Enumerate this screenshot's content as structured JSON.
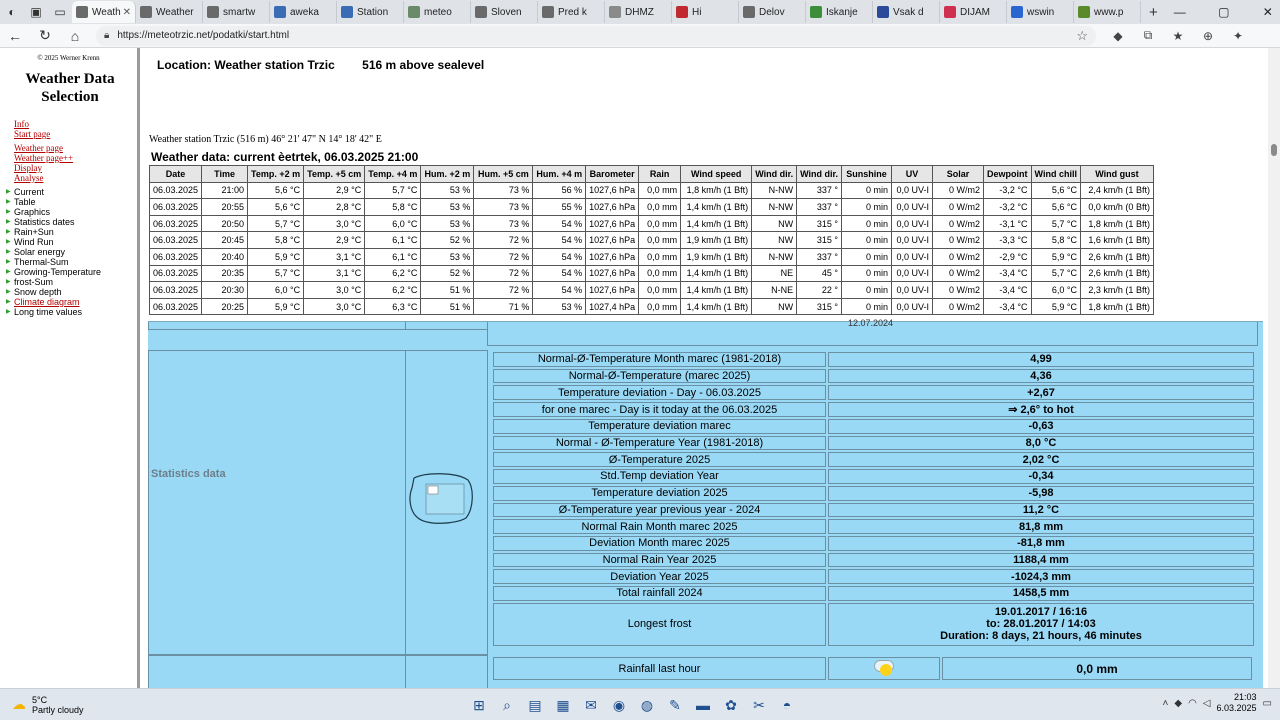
{
  "browser": {
    "tabs": [
      {
        "label": "Weather",
        "active": true,
        "color": "#6a6a6a",
        "icon": "globe-icon"
      },
      {
        "label": "Weather",
        "color": "#6a6a6a",
        "icon": "globe-icon"
      },
      {
        "label": "smartw",
        "color": "#6a6a6a",
        "icon": "globe-icon"
      },
      {
        "label": "aweka",
        "color": "#3a6bb5",
        "icon": "triangle-icon"
      },
      {
        "label": "Station",
        "color": "#3a6bb5",
        "icon": "triangle-icon"
      },
      {
        "label": "meteo",
        "color": "#6a8a6a",
        "icon": "meteo-icon"
      },
      {
        "label": "Sloven",
        "color": "#6a6a6a",
        "icon": "globe-icon"
      },
      {
        "label": "Pred k",
        "color": "#6a6a6a",
        "icon": "globe-icon"
      },
      {
        "label": "DHMZ",
        "color": "#8a8a8a",
        "icon": "page-icon"
      },
      {
        "label": "Hi",
        "color": "#c0292f",
        "icon": "flag-icon"
      },
      {
        "label": "Delov",
        "color": "#6a6a6a",
        "icon": "page-icon"
      },
      {
        "label": "Iskanje",
        "color": "#3b8f3b",
        "icon": "leaf-icon"
      },
      {
        "label": "Vsak d",
        "color": "#2c4a9a",
        "icon": "news-icon"
      },
      {
        "label": "DIJAM",
        "color": "#d03050",
        "icon": "play-icon"
      },
      {
        "label": "wswin",
        "color": "#2a66d0",
        "icon": "search-icon"
      },
      {
        "label": "www.p",
        "color": "#5a8a2a",
        "icon": "site-icon"
      }
    ],
    "url": "https://meteotrzic.net/podatki/start.html"
  },
  "sidebar": {
    "copyright": "© 2025 Werner Krenn",
    "title": "Weather Data Selection",
    "links": [
      "Info",
      "Start page"
    ],
    "links2": [
      "Weather page",
      "Weather page++",
      "Display",
      "Analyse"
    ],
    "list": [
      {
        "label": "Current",
        "link": false
      },
      {
        "label": "Table",
        "link": false
      },
      {
        "label": "Graphics",
        "link": false
      },
      {
        "label": "Statistics dates",
        "link": false
      },
      {
        "label": "Rain+Sun",
        "link": false
      },
      {
        "label": "Wind Run",
        "link": false
      },
      {
        "label": "Solar energy",
        "link": false
      },
      {
        "label": "Thermal-Sum",
        "link": false
      },
      {
        "label": "Growing-Temperature",
        "link": false
      },
      {
        "label": "frost-Sum",
        "link": false
      },
      {
        "label": "Snow depth",
        "link": false
      },
      {
        "label": "Climate diagram",
        "link": true
      },
      {
        "label": "Long time values",
        "link": false
      }
    ]
  },
  "content": {
    "location": "Location: Weather station Trzic",
    "elevation": "516 m above sealevel",
    "station_line": "Weather station Trzic (516 m) 46° 21' 47\" N 14° 18' 42\" E",
    "data_title": "Weather data: current èetrtek, 06.03.2025 21:00",
    "stats_label": "Statistics data",
    "partial_date": "12.07.2024"
  },
  "table": {
    "headers": [
      "Date",
      "Time",
      "Temp. +2 m",
      "Temp. +5 cm",
      "Temp. +4 m",
      "Hum. +2 m",
      "Hum. +5 cm",
      "Hum. +4 m",
      "Barometer",
      "Rain",
      "Wind speed",
      "Wind dir.",
      "Wind dir.",
      "Sunshine",
      "UV",
      "Solar",
      "Dewpoint",
      "Wind chill",
      "Wind gust"
    ],
    "rows": [
      [
        "06.03.2025",
        "21:00",
        "5,6 °C",
        "2,9 °C",
        "5,7 °C",
        "53 %",
        "73 %",
        "56 %",
        "1027,6 hPa",
        "0,0 mm",
        "1,8 km/h (1 Bft)",
        "N-NW",
        "337 °",
        "0 min",
        "0,0 UV-I",
        "0 W/m2",
        "-3,2 °C",
        "5,6 °C",
        "2,4 km/h (1 Bft)"
      ],
      [
        "06.03.2025",
        "20:55",
        "5,6 °C",
        "2,8 °C",
        "5,8 °C",
        "53 %",
        "73 %",
        "55 %",
        "1027,6 hPa",
        "0,0 mm",
        "1,4 km/h (1 Bft)",
        "N-NW",
        "337 °",
        "0 min",
        "0,0 UV-I",
        "0 W/m2",
        "-3,2 °C",
        "5,6 °C",
        "0,0 km/h (0 Bft)"
      ],
      [
        "06.03.2025",
        "20:50",
        "5,7 °C",
        "3,0 °C",
        "6,0 °C",
        "53 %",
        "73 %",
        "54 %",
        "1027,6 hPa",
        "0,0 mm",
        "1,4 km/h (1 Bft)",
        "NW",
        "315 °",
        "0 min",
        "0,0 UV-I",
        "0 W/m2",
        "-3,1 °C",
        "5,7 °C",
        "1,8 km/h (1 Bft)"
      ],
      [
        "06.03.2025",
        "20:45",
        "5,8 °C",
        "2,9 °C",
        "6,1 °C",
        "52 %",
        "72 %",
        "54 %",
        "1027,6 hPa",
        "0,0 mm",
        "1,9 km/h (1 Bft)",
        "NW",
        "315 °",
        "0 min",
        "0,0 UV-I",
        "0 W/m2",
        "-3,3 °C",
        "5,8 °C",
        "1,6 km/h (1 Bft)"
      ],
      [
        "06.03.2025",
        "20:40",
        "5,9 °C",
        "3,1 °C",
        "6,1 °C",
        "53 %",
        "72 %",
        "54 %",
        "1027,6 hPa",
        "0,0 mm",
        "1,9 km/h (1 Bft)",
        "N-NW",
        "337 °",
        "0 min",
        "0,0 UV-I",
        "0 W/m2",
        "-2,9 °C",
        "5,9 °C",
        "2,6 km/h (1 Bft)"
      ],
      [
        "06.03.2025",
        "20:35",
        "5,7 °C",
        "3,1 °C",
        "6,2 °C",
        "52 %",
        "72 %",
        "54 %",
        "1027,6 hPa",
        "0,0 mm",
        "1,4 km/h (1 Bft)",
        "NE",
        "45 °",
        "0 min",
        "0,0 UV-I",
        "0 W/m2",
        "-3,4 °C",
        "5,7 °C",
        "2,6 km/h (1 Bft)"
      ],
      [
        "06.03.2025",
        "20:30",
        "6,0 °C",
        "3,0 °C",
        "6,2 °C",
        "51 %",
        "72 %",
        "54 %",
        "1027,6 hPa",
        "0,0 mm",
        "1,4 km/h (1 Bft)",
        "N-NE",
        "22 °",
        "0 min",
        "0,0 UV-I",
        "0 W/m2",
        "-3,4 °C",
        "6,0 °C",
        "2,3 km/h (1 Bft)"
      ],
      [
        "06.03.2025",
        "20:25",
        "5,9 °C",
        "3,0 °C",
        "6,3 °C",
        "51 %",
        "71 %",
        "53 %",
        "1027,4 hPa",
        "0,0 mm",
        "1,4 km/h (1 Bft)",
        "NW",
        "315 °",
        "0 min",
        "0,0 UV-I",
        "0 W/m2",
        "-3,4 °C",
        "5,9 °C",
        "1,8 km/h (1 Bft)"
      ]
    ]
  },
  "stats": [
    [
      "Normal-Ø-Temperature Month marec (1981-2018)",
      "4,99"
    ],
    [
      "Normal-Ø-Temperature (marec 2025)",
      "4,36"
    ],
    [
      "Temperature deviation - Day - 06.03.2025",
      "+2,67"
    ],
    [
      "for one marec - Day is it today at the 06.03.2025",
      "⇒ 2,6° to hot"
    ],
    [
      "Temperature deviation marec",
      "-0,63"
    ],
    [
      "Normal - Ø-Temperature Year (1981-2018)",
      "8,0 °C"
    ],
    [
      "Ø-Temperature 2025",
      "2,02 °C"
    ],
    [
      "Std.Temp deviation Year",
      "-0,34"
    ],
    [
      "Temperature deviation 2025",
      "-5,98"
    ],
    [
      "Ø-Temperature year previous year - 2024",
      "11,2 °C"
    ],
    [
      "Normal Rain Month marec 2025",
      "81,8 mm"
    ],
    [
      "Deviation Month marec 2025",
      "-81,8 mm"
    ],
    [
      "Normal Rain Year 2025",
      "1188,4 mm"
    ],
    [
      "Deviation Year 2025",
      "-1024,3 mm"
    ],
    [
      "Total rainfall 2024",
      "1458,5 mm"
    ]
  ],
  "frost": {
    "label": "Longest frost",
    "line1": "19.01.2017 / 16:16",
    "line2": "to: 28.01.2017 / 14:03",
    "line3": "Duration: 8 days, 21 hours, 46 minutes"
  },
  "rain": {
    "label": "Rainfall last hour",
    "value": "0,0 mm"
  },
  "taskbar": {
    "temp": "5°C",
    "condition": "Partly cloudy",
    "time": "21:03",
    "date": "6.03.2025"
  }
}
